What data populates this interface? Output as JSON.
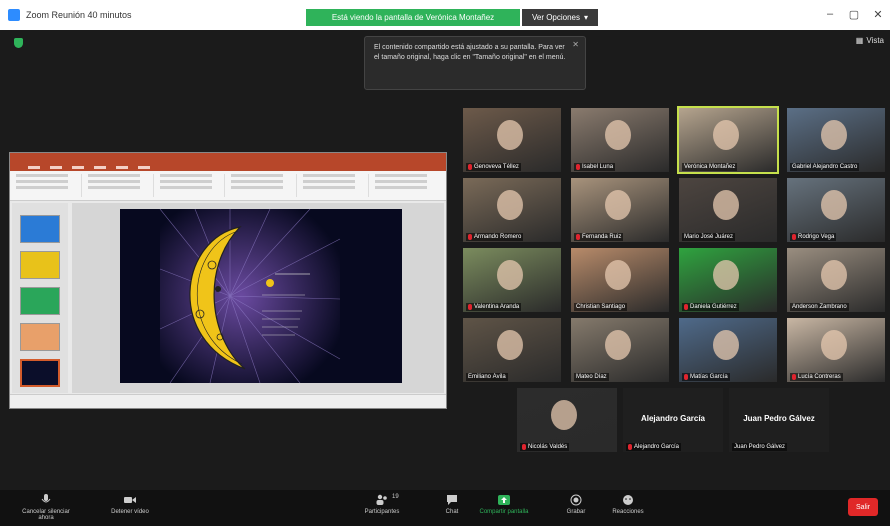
{
  "window": {
    "title": "Zoom Reunión 40 minutos"
  },
  "banner": {
    "share_text": "Está viendo la pantalla de Verónica Montañez",
    "view_options": "Ver Opciones"
  },
  "tooltip": {
    "text": "El contenido compartido está ajustado a su pantalla. Para ver el tamaño original, haga clic en \"Tamaño original\" en el menú."
  },
  "view": {
    "label": "Vista"
  },
  "gallery": [
    {
      "name": "Genoveva Téllez",
      "muted": true
    },
    {
      "name": "Isabel Luna",
      "muted": true
    },
    {
      "name": "Verónica Montañez",
      "muted": false,
      "active": true
    },
    {
      "name": "Gabriel Alejandro Castro",
      "muted": false
    },
    {
      "name": "Armando Romero",
      "muted": true
    },
    {
      "name": "Fernanda Ruiz",
      "muted": true
    },
    {
      "name": "Mario José Juárez",
      "muted": false
    },
    {
      "name": "Rodrigo Vega",
      "muted": true
    },
    {
      "name": "Valentina Aranda",
      "muted": true
    },
    {
      "name": "Christian Santiago",
      "muted": false
    },
    {
      "name": "Daniela Gutiérrez",
      "muted": true
    },
    {
      "name": "Anderson Zambrano",
      "muted": false
    },
    {
      "name": "Emiliano Ávila",
      "muted": false
    },
    {
      "name": "Mateo Díaz",
      "muted": false
    },
    {
      "name": "Matías García",
      "muted": true
    },
    {
      "name": "Lucía Contreras",
      "muted": true
    },
    {
      "name": "Nicolás Valdés",
      "muted": true
    },
    {
      "name": "Alejandro García",
      "muted": true,
      "big": "Alejandro García"
    },
    {
      "name": "Juan Pedro Gálvez",
      "muted": false,
      "big": "Juan Pedro Gálvez"
    }
  ],
  "toolbar": {
    "unmute": "Cancelar silenciar ahora",
    "video": "Detener vídeo",
    "participants": "Participantes",
    "participants_count": "19",
    "chat": "Chat",
    "share": "Compartir pantalla",
    "record": "Grabar",
    "reactions": "Reacciones",
    "leave": "Salir"
  }
}
